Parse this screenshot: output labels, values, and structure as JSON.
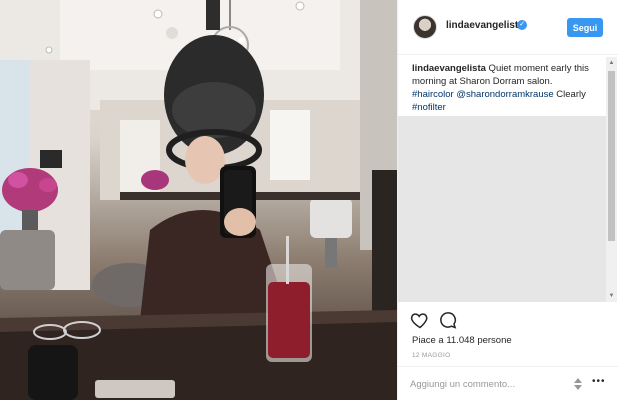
{
  "post": {
    "username": "lindaevangelista",
    "follow_label": "Segui",
    "caption": {
      "username": "lindaevangelista",
      "text": " Quiet moment early this morning at Sharon Dorram salon. ",
      "tag1": "#haircolor",
      "mention": " @sharondorramkrause",
      "text2": " Clearly ",
      "tag2": "#nofilter"
    },
    "likes": "Piace a 11.048 persone",
    "date": "12 MAGGIO",
    "comment_placeholder": "Aggiungi un commento...",
    "more_label": "•••"
  },
  "colors": {
    "accent": "#3897f0",
    "hashtag": "#003569",
    "muted": "#999999"
  },
  "icons": {
    "like": "heart-icon",
    "comment": "comment-icon",
    "verified": "verified-badge-icon",
    "more": "more-options-icon"
  }
}
